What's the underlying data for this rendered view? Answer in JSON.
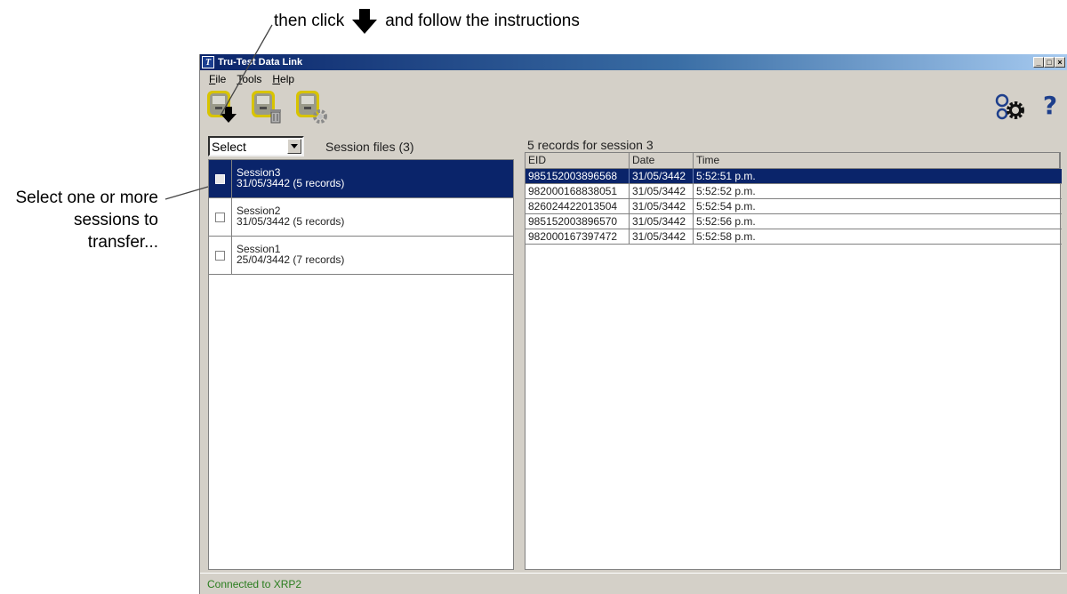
{
  "annotations": {
    "top_prefix": "then click",
    "top_suffix": "and follow the instructions",
    "left_line1": "Select one or more",
    "left_line2": "sessions to",
    "left_line3": "transfer..."
  },
  "window": {
    "title": "Tru-Test Data Link",
    "app_icon_letter": "T",
    "minimize": "_",
    "maximize": "□",
    "close": "×"
  },
  "menu": {
    "file": {
      "hot": "F",
      "rest": "ile"
    },
    "tools": {
      "hot": "T",
      "rest": "ools"
    },
    "help": {
      "hot": "H",
      "rest": "elp"
    }
  },
  "toolbar": {
    "transfer_icon": "transfer-to-pc-icon",
    "delete_icon": "delete-session-icon",
    "settings_icon": "device-settings-icon",
    "help_label": "?"
  },
  "left_panel": {
    "select_value": "Select",
    "session_files_label": "Session files (3)",
    "sessions": [
      {
        "name": "Session3",
        "detail": "31/05/3442  (5 records)",
        "selected": true
      },
      {
        "name": "Session2",
        "detail": "31/05/3442  (5 records)",
        "selected": false
      },
      {
        "name": "Session1",
        "detail": "25/04/3442  (7 records)",
        "selected": false
      }
    ]
  },
  "right_panel": {
    "records_label": "5 records for session 3",
    "columns": [
      "EID",
      "Date",
      "Time"
    ],
    "rows": [
      [
        "985152003896568",
        "31/05/3442",
        "5:52:51 p.m."
      ],
      [
        "982000168838051",
        "31/05/3442",
        "5:52:52 p.m."
      ],
      [
        "826024422013504",
        "31/05/3442",
        "5:52:54 p.m."
      ],
      [
        "985152003896570",
        "31/05/3442",
        "5:52:56 p.m."
      ],
      [
        "982000167397472",
        "31/05/3442",
        "5:52:58 p.m."
      ]
    ]
  },
  "status": {
    "text": "Connected to XRP2"
  },
  "colors": {
    "selection": "#0a246a",
    "status_text": "#2a7d1e",
    "device_body": "#c8c87a",
    "device_frame": "#d8c400"
  }
}
